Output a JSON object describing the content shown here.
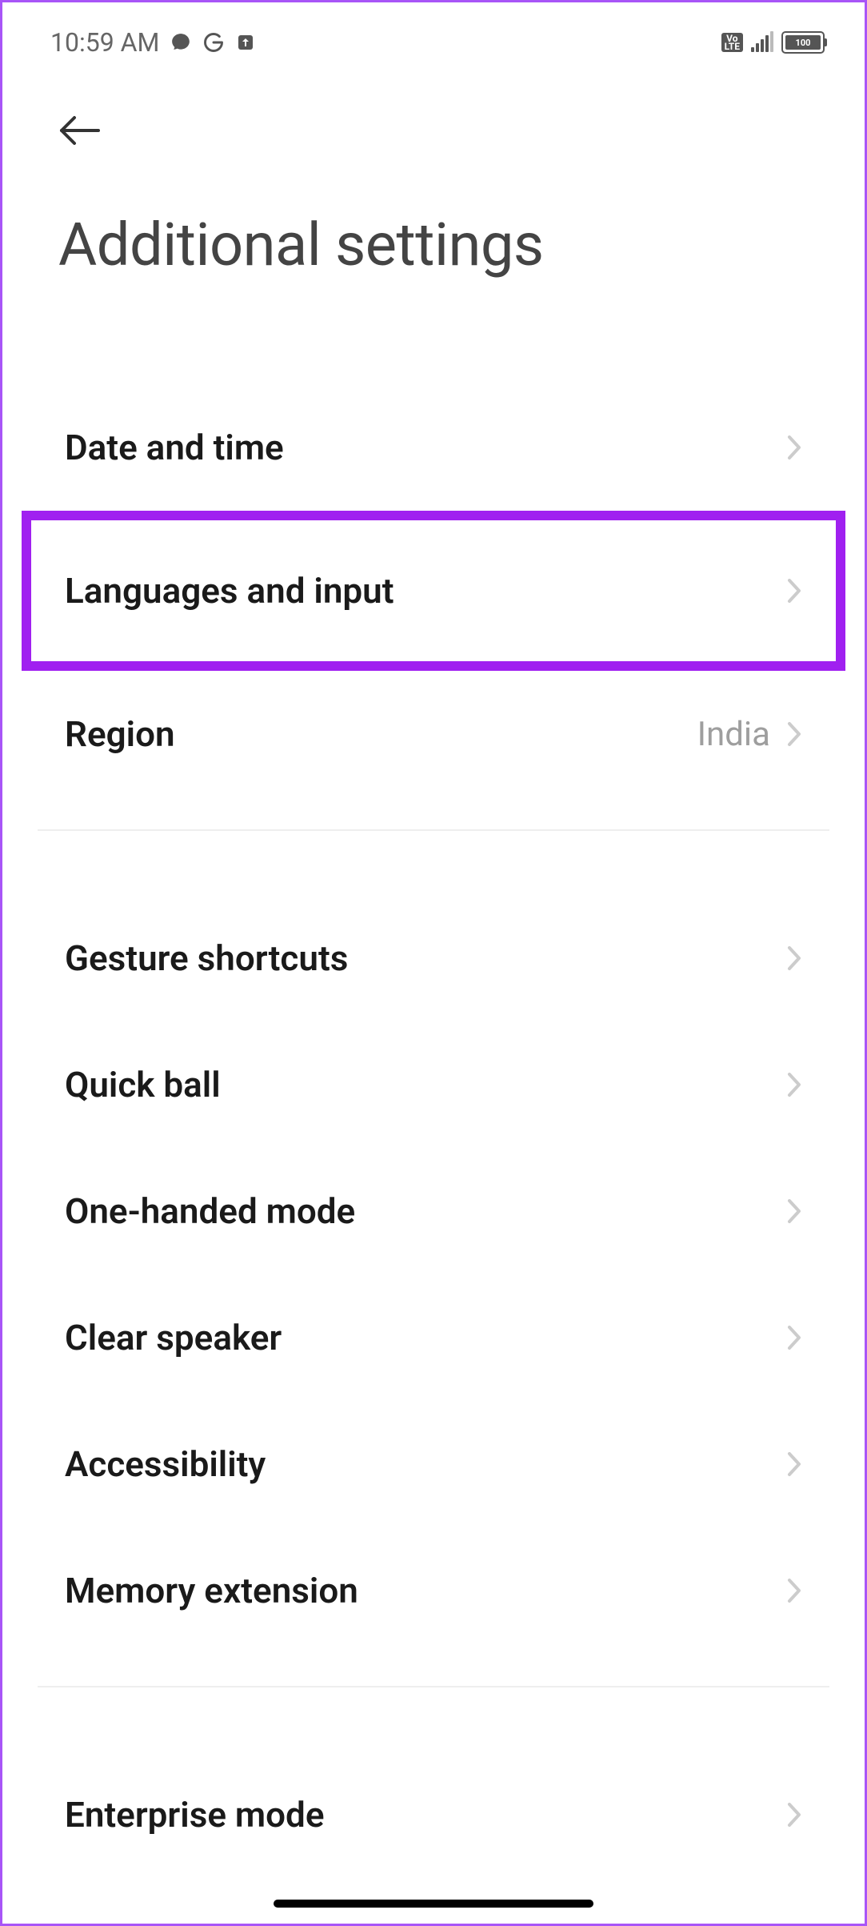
{
  "statusBar": {
    "time": "10:59 AM",
    "volte": "Vo\nLTE",
    "batteryLevel": "100"
  },
  "page": {
    "title": "Additional settings"
  },
  "rows": {
    "dateTime": {
      "label": "Date and time"
    },
    "languages": {
      "label": "Languages and input"
    },
    "region": {
      "label": "Region",
      "value": "India"
    },
    "gesture": {
      "label": "Gesture shortcuts"
    },
    "quickBall": {
      "label": "Quick ball"
    },
    "oneHanded": {
      "label": "One-handed mode"
    },
    "clearSpeaker": {
      "label": "Clear speaker"
    },
    "accessibility": {
      "label": "Accessibility"
    },
    "memoryExt": {
      "label": "Memory extension"
    },
    "enterprise": {
      "label": "Enterprise mode"
    }
  }
}
